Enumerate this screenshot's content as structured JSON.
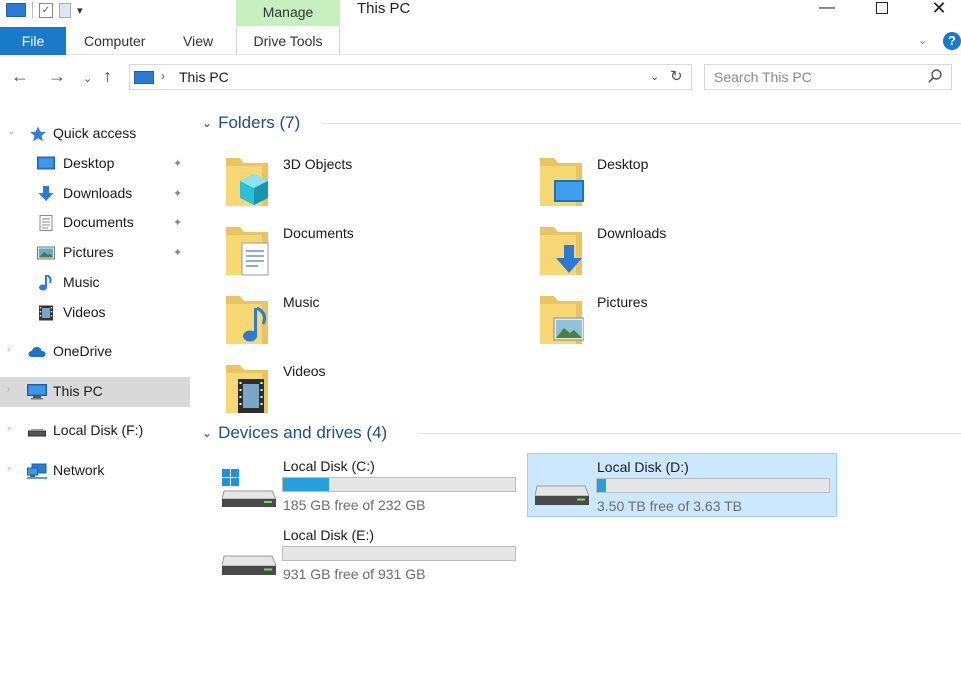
{
  "window": {
    "title": "This PC",
    "minimize_glyph": "—",
    "close_glyph": "✕"
  },
  "quick_access_toolbar": {
    "dropdown_glyph": "▾"
  },
  "ribbon": {
    "context_group_label": "Manage",
    "tabs": [
      {
        "label": "File"
      },
      {
        "label": "Computer"
      },
      {
        "label": "View"
      },
      {
        "label": "Drive Tools"
      }
    ],
    "collapse_glyph": "⌄",
    "help_glyph": "?"
  },
  "navigation": {
    "back_glyph": "←",
    "forward_glyph": "→",
    "recent_glyph": "⌄",
    "up_glyph": "↑",
    "address": {
      "separator_glyph": "›",
      "crumb": "This PC",
      "dropdown_glyph": "⌄",
      "refresh_glyph": "↻"
    },
    "search": {
      "placeholder": "Search This PC"
    }
  },
  "sidebar": {
    "items": [
      {
        "label": "Quick access",
        "icon": "star-icon"
      },
      {
        "label": "Desktop",
        "icon": "desktop-icon",
        "pinned": true
      },
      {
        "label": "Downloads",
        "icon": "download-icon",
        "pinned": true
      },
      {
        "label": "Documents",
        "icon": "document-icon",
        "pinned": true
      },
      {
        "label": "Pictures",
        "icon": "picture-icon",
        "pinned": true
      },
      {
        "label": "Music",
        "icon": "music-icon"
      },
      {
        "label": "Videos",
        "icon": "video-icon"
      },
      {
        "label": "OneDrive",
        "icon": "cloud-icon"
      },
      {
        "label": "This PC",
        "icon": "pc-icon",
        "selected": true
      },
      {
        "label": "Local Disk (F:)",
        "icon": "usb-drive-icon"
      },
      {
        "label": "Network",
        "icon": "network-icon"
      }
    ],
    "expand_glyph": "›",
    "collapse_glyph": "⌄",
    "pin_glyph": "✦"
  },
  "folders_group": {
    "title": "Folders (7)",
    "chevron_glyph": "⌄",
    "items": [
      {
        "name": "3D Objects",
        "overlay": "cube"
      },
      {
        "name": "Desktop",
        "overlay": "desktop"
      },
      {
        "name": "Documents",
        "overlay": "document"
      },
      {
        "name": "Downloads",
        "overlay": "download"
      },
      {
        "name": "Music",
        "overlay": "music"
      },
      {
        "name": "Pictures",
        "overlay": "picture"
      },
      {
        "name": "Videos",
        "overlay": "film"
      }
    ]
  },
  "drives_group": {
    "title": "Devices and drives (4)",
    "chevron_glyph": "⌄",
    "items": [
      {
        "name": "Local Disk (C:)",
        "free_text": "185 GB free of 232 GB",
        "used_fraction": 0.2,
        "system": true,
        "selected": false
      },
      {
        "name": "Local Disk (D:)",
        "free_text": "3.50 TB free of 3.63 TB",
        "used_fraction": 0.04,
        "system": false,
        "selected": true
      },
      {
        "name": "Local Disk (E:)",
        "free_text": "931 GB free of 931 GB",
        "used_fraction": 0.0,
        "system": false,
        "selected": false
      }
    ]
  },
  "colors": {
    "accent": "#1979ca",
    "manage_tab": "#c7efc0",
    "group_header": "#1e4e8c",
    "selection_bg": "#cce8ff",
    "selection_border": "#99d1ff",
    "usage_bar": "#26a0da",
    "sidebar_selected": "#d9d9d9",
    "folder_yellow": "#f8d775"
  }
}
